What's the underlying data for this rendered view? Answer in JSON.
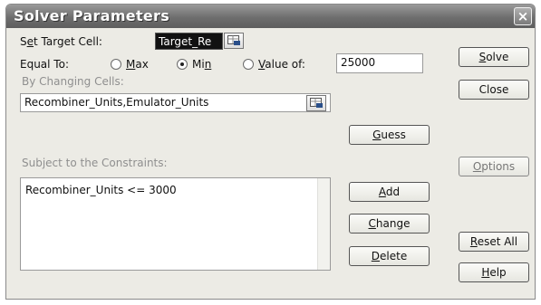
{
  "window": {
    "title": "Solver Parameters",
    "close_glyph": "×"
  },
  "target_cell": {
    "label_prefix": "S",
    "label_mnemonic": "e",
    "label_suffix": "t Target Cell:",
    "value": "Target_Re"
  },
  "equal_to": {
    "label": "Equal To:",
    "options": [
      {
        "mnemonic": "M",
        "rest": "ax",
        "selected": false
      },
      {
        "pre": "Mi",
        "mnemonic": "n",
        "rest": "",
        "selected": true
      },
      {
        "mnemonic": "V",
        "rest": "alue of:",
        "selected": false
      }
    ],
    "value_of": "25000"
  },
  "changing_cells": {
    "label": "By Changing Cells:",
    "value": "Recombiner_Units,Emulator_Units"
  },
  "constraints": {
    "label": "Subject to the Constraints:",
    "items": [
      "Recombiner_Units <= 3000"
    ]
  },
  "buttons": {
    "solve": {
      "mnemonic": "S",
      "rest": "olve"
    },
    "close": "Close",
    "guess": {
      "mnemonic": "G",
      "rest": "uess"
    },
    "options": {
      "mnemonic": "O",
      "rest": "ptions"
    },
    "add": {
      "mnemonic": "A",
      "rest": "dd"
    },
    "change": {
      "mnemonic": "C",
      "rest": "hange"
    },
    "delete": {
      "mnemonic": "D",
      "rest": "elete"
    },
    "reset": {
      "mnemonic": "R",
      "rest": "eset All"
    },
    "help": {
      "mnemonic": "H",
      "rest": "elp"
    }
  },
  "icons": {
    "ref_button": "cell-reference-icon",
    "close": "close-icon"
  }
}
